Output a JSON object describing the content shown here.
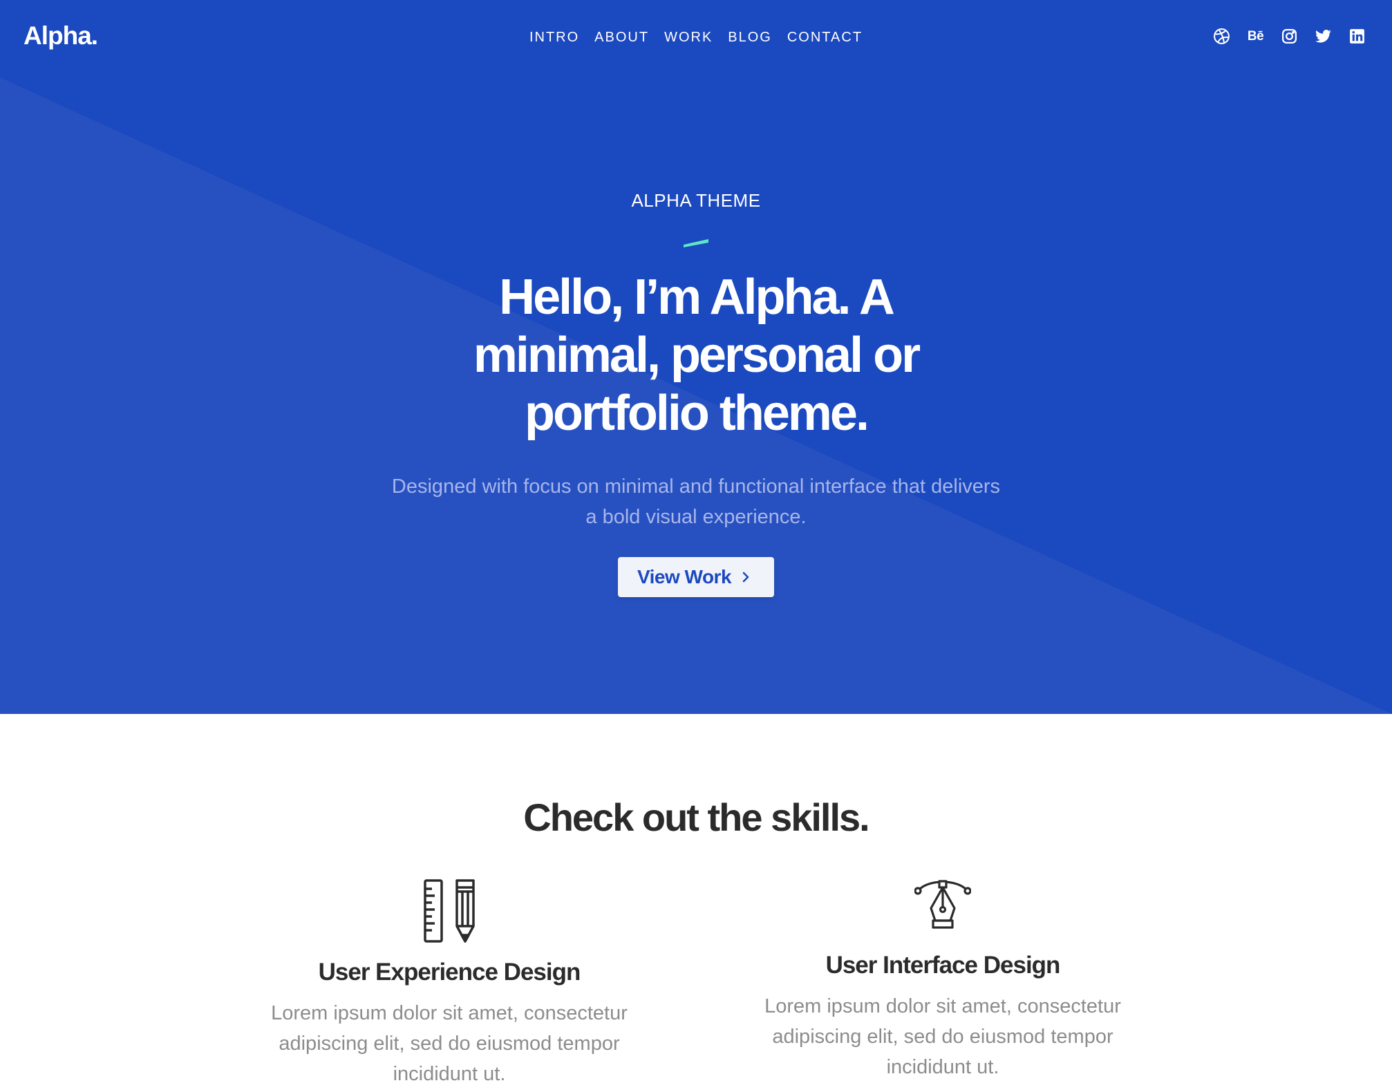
{
  "brand": {
    "logo": "Alpha."
  },
  "nav": {
    "items": [
      {
        "label": "INTRO"
      },
      {
        "label": "ABOUT"
      },
      {
        "label": "WORK"
      },
      {
        "label": "BLOG"
      },
      {
        "label": "CONTACT"
      }
    ]
  },
  "social": {
    "items": [
      {
        "icon": "dribbble-icon"
      },
      {
        "icon": "behance-icon",
        "text": "Bē"
      },
      {
        "icon": "instagram-icon"
      },
      {
        "icon": "twitter-icon"
      },
      {
        "icon": "linkedin-icon"
      }
    ]
  },
  "hero": {
    "eyebrow": "ALPHA THEME",
    "headline": "Hello, I’m Alpha. A minimal, personal or portfolio theme.",
    "subline": "Designed with focus on minimal and functional interface that delivers a bold visual experience.",
    "cta_label": "View Work",
    "cta_icon": "chevron-right-icon"
  },
  "skills": {
    "title": "Check out the skills.",
    "items": [
      {
        "icon": "ruler-pencil-icon",
        "title": "User Experience Design",
        "description": "Lorem ipsum dolor sit amet, consectetur adipiscing elit, sed do eiusmod tempor incididunt ut."
      },
      {
        "icon": "pen-tool-icon",
        "title": "User Interface Design",
        "description": "Lorem ipsum dolor sit amet, consectetur adipiscing elit, sed do eiusmod tempor incididunt ut."
      }
    ]
  },
  "colors": {
    "hero_bg": "#1b49bf",
    "hero_diagonal": "#2751c1",
    "accent": "#5ee6c5",
    "heading_dark": "#2b2b2b",
    "body_gray": "#8c8c8c",
    "subline": "#a8b6ea"
  }
}
